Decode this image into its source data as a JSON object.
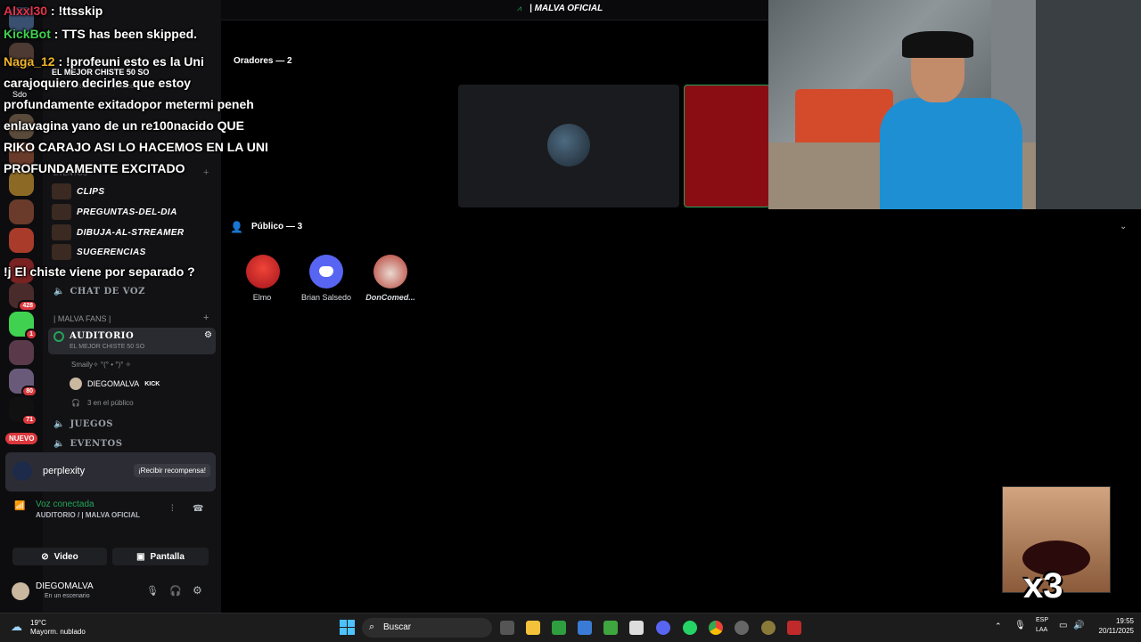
{
  "top": {
    "channel_title": "| MALVA OFICIAL"
  },
  "stage": {
    "speakers_label": "Oradores — 2",
    "audience_label": "Público — 3",
    "audience": [
      {
        "name": "Elmo"
      },
      {
        "name": "Brian Salsedo"
      },
      {
        "name": "DonComed..."
      }
    ]
  },
  "channels": {
    "faded_header": "EL MEJOR CHISTE 50 SO",
    "faded_sub": "AUDITORIO · 3 en el público",
    "events_category": "EVENTOS",
    "text_channels": [
      {
        "label": "CLIPS"
      },
      {
        "label": "PREGUNTAS-DEL-DIA"
      },
      {
        "label": "DIBUJA-AL-STREAMER"
      },
      {
        "label": "SUGERENCIAS"
      }
    ],
    "voice_chat": "CHAT DE VOZ",
    "fans_category": "| MALVA FANS |",
    "auditorio": "AUDITORIO",
    "auditorio_sub": "EL MEJOR CHISTE 50 SO",
    "members": [
      {
        "name": "Smaily✧ °(° • °)° ✧"
      },
      {
        "name": "DIEGOMALVA",
        "badge": "KICK"
      }
    ],
    "public_count": "3 en el público",
    "juegos": "JUEGOS",
    "eventos": "EVENTOS"
  },
  "rail": {
    "badges": [
      "428",
      "1",
      "80",
      "71"
    ],
    "nuevo": "NUEVO",
    "sdo": "Sdo"
  },
  "promo": {
    "brand": "perplexity",
    "cta": "¡Recibir recompensa!"
  },
  "voice": {
    "status": "Voz conectada",
    "location": "AUDITORIO / | MALVA OFICIAL",
    "video_btn": "Video",
    "screen_btn": "Pantalla"
  },
  "user": {
    "name": "DIEGOMALVA",
    "status": "En un escenario"
  },
  "overlay_chat": [
    {
      "user": "Alxxl30",
      "sep": " : ",
      "text": "!ttsskip",
      "color": "#e0344a"
    },
    {
      "user": "KickBot",
      "sep": " : ",
      "text": "TTS has been skipped.",
      "color": "#3fd14f"
    },
    {
      "user": "Naga_12",
      "sep": " : ",
      "text": "!profeuni esto es la Uni",
      "color": "#f0b429"
    },
    {
      "user": "",
      "sep": "",
      "text": "carajoquiero decirles que estoy",
      "color": ""
    },
    {
      "user": "",
      "sep": "",
      "text": "profundamente exitadopor metermi peneh",
      "color": ""
    },
    {
      "user": "",
      "sep": "",
      "text": "enlavagina yano de un re100nacido QUE",
      "color": ""
    },
    {
      "user": "",
      "sep": "",
      "text": "RIKO CARAJO ASI LO HACEMOS EN LA UNI",
      "color": ""
    },
    {
      "user": "",
      "sep": "",
      "text": "PROFUNDAMENTE EXCITADO",
      "color": ""
    },
    {
      "user": "",
      "sep": "",
      "text": "!j El chiste viene por separado ?",
      "color": ""
    }
  ],
  "meme": {
    "caption": "x3"
  },
  "taskbar": {
    "weather_temp": "19°C",
    "weather_desc": "Mayorm. nublado",
    "search": "Buscar",
    "lang1": "ESP",
    "lang2": "LAA",
    "time": "19:55",
    "date": "20/11/2025"
  },
  "colors": {
    "accent_green": "#23a55a",
    "discord_blurple": "#5865f2",
    "alert_red": "#da373c"
  }
}
